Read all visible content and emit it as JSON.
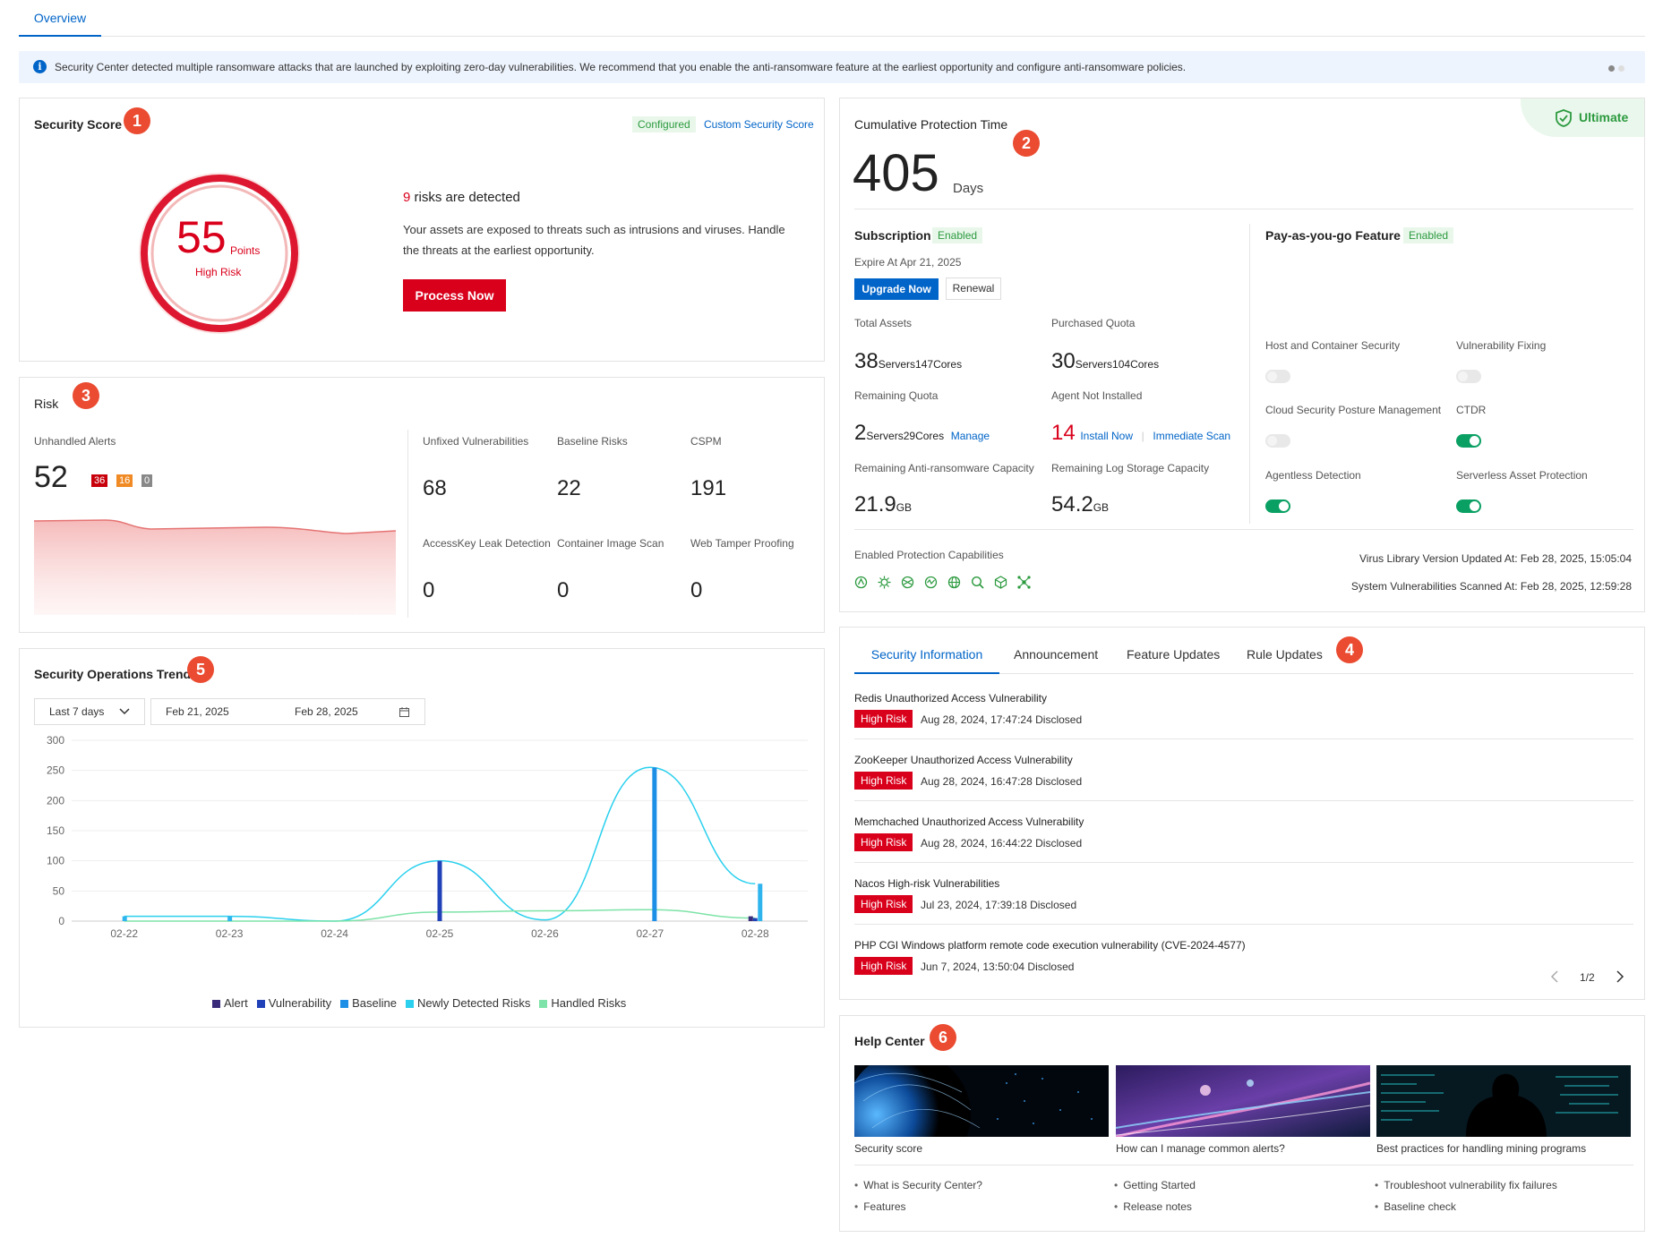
{
  "tabs": {
    "overview": "Overview"
  },
  "notice": {
    "text": "Security Center detected multiple ransomware attacks that are launched by exploiting zero-day vulnerabilities. We recommend that you enable the anti-ransomware feature at the earliest opportunity and configure anti-ransomware policies."
  },
  "security_score": {
    "title": "Security Score",
    "badge": "1",
    "configured": "Configured",
    "custom_link": "Custom Security Score",
    "score": "55",
    "unit": "Points",
    "level": "High Risk",
    "risk_count": "9",
    "risk_text": "risks are detected",
    "desc_line1": "Your assets are exposed to threats such as intrusions and viruses. Handle",
    "desc_line2": "the threats at the earliest opportunity.",
    "process_btn": "Process Now"
  },
  "risk": {
    "title": "Risk",
    "badge": "3",
    "unhandled_label": "Unhandled Alerts",
    "unhandled_value": "52",
    "sev_high": "36",
    "sev_med": "16",
    "sev_low": "0",
    "metrics": [
      {
        "label": "Unfixed Vulnerabilities",
        "value": "68"
      },
      {
        "label": "Baseline Risks",
        "value": "22"
      },
      {
        "label": "CSPM",
        "value": "191"
      },
      {
        "label": "AccessKey Leak Detection",
        "value": "0"
      },
      {
        "label": "Container Image Scan",
        "value": "0"
      },
      {
        "label": "Web Tamper Proofing",
        "value": "0"
      }
    ]
  },
  "trend": {
    "title": "Security Operations Trend",
    "badge": "5",
    "range_select": "Last 7 days",
    "date_start": "Feb 21, 2025",
    "date_end": "Feb 28, 2025"
  },
  "chart_data": {
    "type": "bar",
    "title": "",
    "categories": [
      "02-22",
      "02-23",
      "02-24",
      "02-25",
      "02-26",
      "02-27",
      "02-28"
    ],
    "ylim": [
      0,
      300
    ],
    "yticks": [
      "300",
      "250",
      "200",
      "150",
      "100",
      "50",
      "0"
    ],
    "series": [
      {
        "name": "Alert",
        "type": "bar",
        "color": "#3a2a7a",
        "values": [
          0,
          0,
          0,
          0,
          0,
          0,
          8
        ]
      },
      {
        "name": "Vulnerability",
        "type": "bar",
        "color": "#2141b8",
        "values": [
          0,
          0,
          0,
          100,
          0,
          0,
          5
        ]
      },
      {
        "name": "Baseline",
        "type": "bar",
        "color": "#1e8fe6",
        "values": [
          0,
          0,
          0,
          0,
          0,
          255,
          0
        ]
      },
      {
        "name": "Newly Detected Risks",
        "type": "line",
        "color": "#2ad0ee",
        "values": [
          8,
          8,
          0,
          100,
          2,
          255,
          62
        ]
      },
      {
        "name": "Handled Risks",
        "type": "line",
        "color": "#7ee3a8",
        "values": [
          0,
          0,
          0,
          15,
          17,
          19,
          5
        ]
      }
    ],
    "legend_position": "bottom"
  },
  "protection": {
    "title": "Cumulative Protection Time",
    "badge": "2",
    "edition": "Ultimate",
    "days": "405",
    "days_unit": "Days",
    "subscription_label": "Subscription",
    "subscription_status": "Enabled",
    "expire": "Expire At Apr 21, 2025",
    "upgrade_btn": "Upgrade Now",
    "renewal_btn": "Renewal",
    "total_assets_label": "Total Assets",
    "total_assets": {
      "n1": "38",
      "u1": "Servers",
      "n2": "147",
      "u2": "Cores"
    },
    "purchased_label": "Purchased Quota",
    "purchased": {
      "n1": "30",
      "u1": "Servers",
      "n2": "104",
      "u2": "Cores"
    },
    "remaining_label": "Remaining Quota",
    "remaining": {
      "n1": "2",
      "u1": "Servers",
      "n2": "29",
      "u2": "Cores"
    },
    "manage_link": "Manage",
    "agent_label": "Agent Not Installed",
    "agent_value": "14",
    "install_link": "Install Now",
    "scan_link": "Immediate Scan",
    "ransom_label": "Remaining Anti-ransomware Capacity",
    "ransom_value": "21.9",
    "ransom_unit": "GB",
    "log_label": "Remaining Log Storage Capacity",
    "log_value": "54.2",
    "log_unit": "GB",
    "payg_label": "Pay-as-you-go Feature",
    "payg_status": "Enabled",
    "features": [
      {
        "label": "Host and Container Security",
        "on": false
      },
      {
        "label": "Vulnerability Fixing",
        "on": false
      },
      {
        "label": "Cloud Security Posture Management",
        "on": false
      },
      {
        "label": "CTDR",
        "on": true
      },
      {
        "label": "Agentless Detection",
        "on": true
      },
      {
        "label": "Serverless Asset Protection",
        "on": true
      }
    ],
    "capabilities_label": "Enabled Protection Capabilities",
    "virus_update": "Virus Library Version Updated At: Feb 28, 2025, 15:05:04",
    "vuln_scan": "System Vulnerabilities Scanned At: Feb 28, 2025, 12:59:28"
  },
  "news": {
    "badge": "4",
    "tabs": [
      "Security Information",
      "Announcement",
      "Feature Updates",
      "Rule Updates"
    ],
    "items": [
      {
        "title": "Redis Unauthorized Access Vulnerability",
        "level": "High Risk",
        "date": "Aug 28, 2024, 17:47:24 Disclosed"
      },
      {
        "title": "ZooKeeper Unauthorized Access Vulnerability",
        "level": "High Risk",
        "date": "Aug 28, 2024, 16:47:28 Disclosed"
      },
      {
        "title": "Memchached Unauthorized Access Vulnerability",
        "level": "High Risk",
        "date": "Aug 28, 2024, 16:44:22 Disclosed"
      },
      {
        "title": "Nacos High-risk Vulnerabilities",
        "level": "High Risk",
        "date": "Jul 23, 2024, 17:39:18 Disclosed"
      },
      {
        "title": "PHP CGI Windows platform remote code execution vulnerability (CVE-2024-4577)",
        "level": "High Risk",
        "date": "Jun 7, 2024, 13:50:04 Disclosed"
      }
    ],
    "page": "1/2"
  },
  "help": {
    "title": "Help Center",
    "badge": "6",
    "cards": [
      {
        "caption": "Security score"
      },
      {
        "caption": "How can I manage common alerts?"
      },
      {
        "caption": "Best practices for handling mining programs"
      }
    ],
    "links": [
      [
        "What is Security Center?",
        "Features"
      ],
      [
        "Getting Started",
        "Release notes"
      ],
      [
        "Troubleshoot vulnerability fix failures",
        "Baseline check"
      ]
    ]
  },
  "colors": {
    "accent": "#0064c8",
    "danger": "#d9001b",
    "success": "#0aa063",
    "marker": "#ea4b31"
  }
}
